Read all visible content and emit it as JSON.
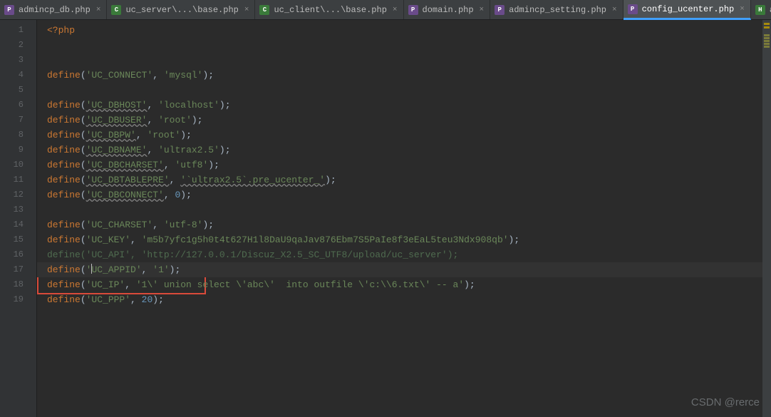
{
  "tabs": [
    {
      "label": "admincp_db.php",
      "icon": "php",
      "active": false
    },
    {
      "label": "uc_server\\...\\base.php",
      "icon": "cfg",
      "active": false
    },
    {
      "label": "uc_client\\...\\base.php",
      "icon": "cfg",
      "active": false
    },
    {
      "label": "domain.php",
      "icon": "php",
      "active": false
    },
    {
      "label": "admincp_setting.php",
      "icon": "php",
      "active": false
    },
    {
      "label": "config_ucenter.php",
      "icon": "php",
      "active": true
    },
    {
      "label": "admin_app.htm",
      "icon": "htm",
      "active": false
    }
  ],
  "watermark": "CSDN @rerce",
  "code": {
    "open_tag": "<?php",
    "lines": [
      {
        "n": 1,
        "type": "open"
      },
      {
        "n": 2,
        "type": "blank"
      },
      {
        "n": 3,
        "type": "blank"
      },
      {
        "n": 4,
        "type": "def",
        "key": "UC_CONNECT",
        "val": "'mysql'"
      },
      {
        "n": 5,
        "type": "blank"
      },
      {
        "n": 6,
        "type": "def",
        "key": "UC_DBHOST",
        "val": "'localhost'",
        "wavy": true
      },
      {
        "n": 7,
        "type": "def",
        "key": "UC_DBUSER",
        "val": "'root'",
        "wavy": true
      },
      {
        "n": 8,
        "type": "def",
        "key": "UC_DBPW",
        "val": "'root'",
        "wavy": true
      },
      {
        "n": 9,
        "type": "def",
        "key": "UC_DBNAME",
        "val": "'ultrax2.5'",
        "wavy": true
      },
      {
        "n": 10,
        "type": "def",
        "key": "UC_DBCHARSET",
        "val": "'utf8'",
        "wavy": true
      },
      {
        "n": 11,
        "type": "defdb",
        "key": "UC_DBTABLEPRE",
        "raw": "'`ultrax2.5`.pre_ucenter_'",
        "wavy": true
      },
      {
        "n": 12,
        "type": "defn",
        "key": "UC_DBCONNECT",
        "num": "0",
        "wavy": true
      },
      {
        "n": 13,
        "type": "blank"
      },
      {
        "n": 14,
        "type": "def",
        "key": "UC_CHARSET",
        "val": "'utf-8'"
      },
      {
        "n": 15,
        "type": "def",
        "key": "UC_KEY",
        "val": "'m5b7yfc1g5h0t4t627H1l8DaU9qaJav876Ebm7S5PaIe8f3eEaL5teu3Ndx908qb'"
      },
      {
        "n": 16,
        "type": "dim",
        "text": "define('UC_API', 'http://127.0.0.1/Discuz_X2.5_SC_UTF8/upload/uc_server');"
      },
      {
        "n": 17,
        "type": "cur",
        "key": "UC_APPID",
        "val": "'1'"
      },
      {
        "n": 18,
        "type": "def",
        "key": "UC_IP",
        "val": "'1\\' union select \\'abc\\'  into outfile \\'c:\\\\6.txt\\' -- a'"
      },
      {
        "n": 19,
        "type": "defn",
        "key": "UC_PPP",
        "num": "20"
      }
    ]
  }
}
